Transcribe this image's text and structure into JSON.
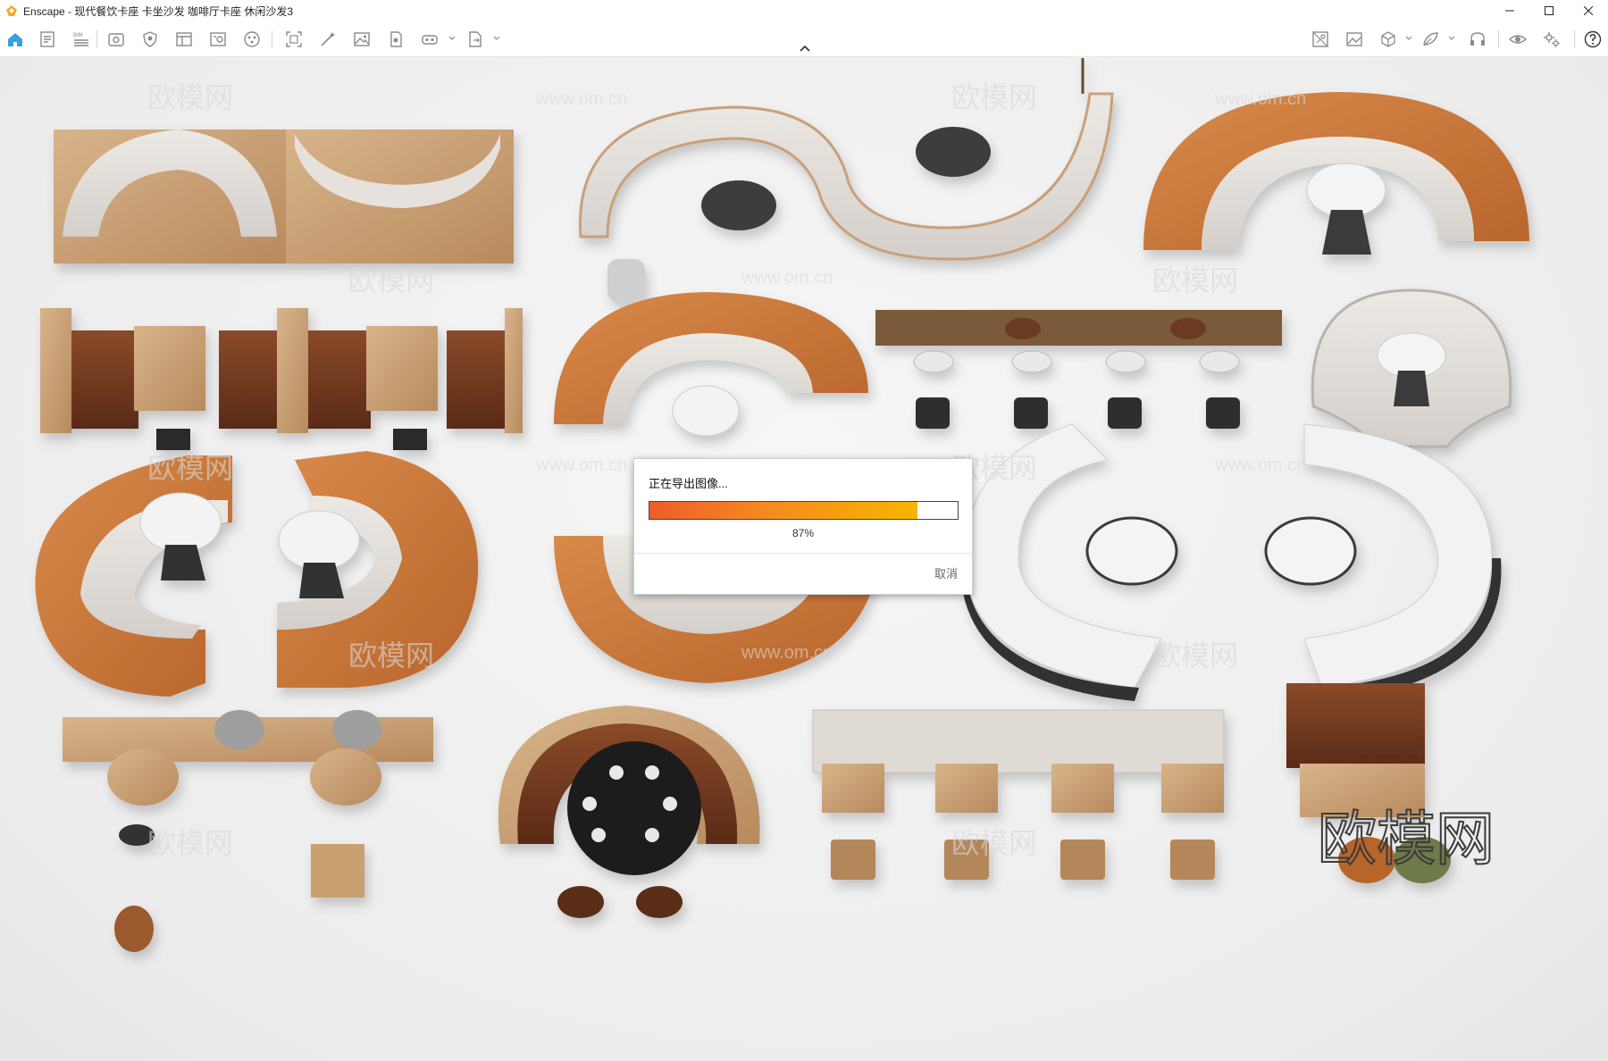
{
  "window": {
    "app_name": "Enscape",
    "title": "Enscape - 现代餐饮卡座 卡坐沙发 咖啡厅卡座  休闲沙发3"
  },
  "window_controls": [
    "minimize-icon",
    "maximize-icon",
    "close-icon"
  ],
  "toolbar": {
    "left_icons": [
      "home-icon",
      "document-icon",
      "bim-list-icon",
      "view-icon",
      "material-shield-icon",
      "panel-icon",
      "image-document-icon",
      "asset-library-icon",
      "screenshot-frame-icon",
      "wand-icon",
      "picture-icon",
      "batch-render-icon",
      "vr-headset-icon",
      "export-document-icon"
    ],
    "right_icons": [
      "site-context-icon",
      "image-gallery-icon",
      "cube-icon",
      "atmosphere-icon",
      "headset-icon",
      "eye-icon",
      "settings-icon",
      "help-icon"
    ]
  },
  "dialog": {
    "message": "正在导出图像...",
    "progress": 0.87,
    "progress_label": "87%",
    "cancel_label": "取消",
    "colors": {
      "start": "#ee5d2b",
      "end": "#f7b500"
    }
  },
  "scene": {
    "watermark_text": "欧模网",
    "watermark_url": "www.om.cn",
    "brand_logo_text": "欧模网"
  },
  "colors": {
    "leather_orange": "#c9773a",
    "fabric_light": "#e3dfdb",
    "wood": "#c8a27a",
    "dark_leather": "#6b3520",
    "black_base": "#3b3b3b"
  }
}
